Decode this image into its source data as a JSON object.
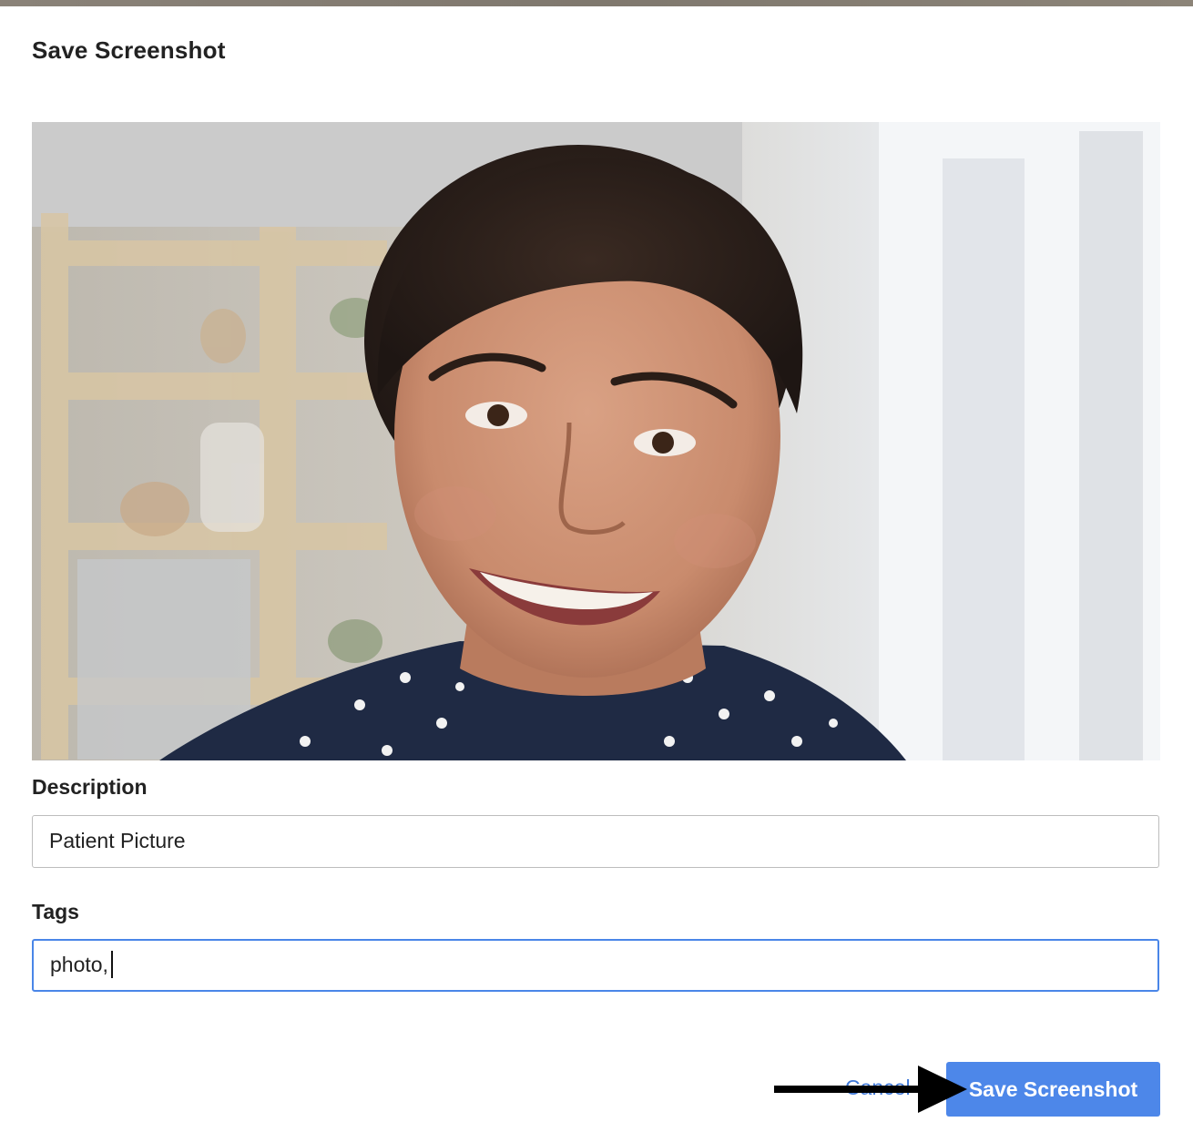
{
  "dialog": {
    "title": "Save Screenshot"
  },
  "preview": {
    "subject": "smiling woman portrait photo"
  },
  "form": {
    "description": {
      "label": "Description",
      "value": "Patient Picture"
    },
    "tags": {
      "label": "Tags",
      "value": "photo,"
    }
  },
  "actions": {
    "cancel_label": "Cancel",
    "save_label": "Save Screenshot"
  },
  "colors": {
    "primary": "#4d87e9",
    "focus_border": "#4a86e8",
    "link": "#3f78d8"
  },
  "annotation": {
    "arrow_icon": "arrow-right-icon"
  }
}
